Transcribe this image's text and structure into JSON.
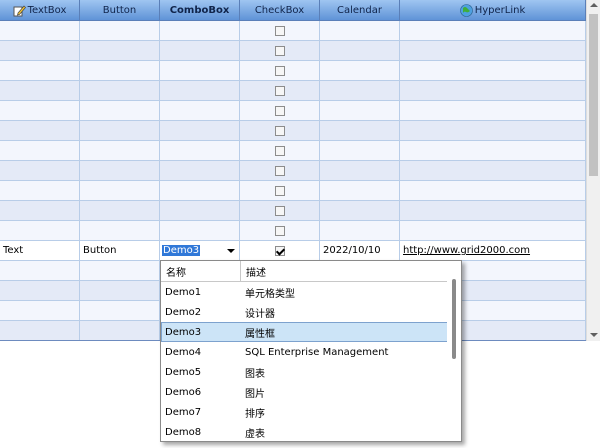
{
  "columns": [
    {
      "label": "TextBox",
      "icon": "pencil-icon",
      "bold": false
    },
    {
      "label": "Button",
      "bold": false
    },
    {
      "label": "ComboBox",
      "bold": true
    },
    {
      "label": "CheckBox",
      "bold": false
    },
    {
      "label": "Calendar",
      "bold": false
    },
    {
      "label": "HyperLink",
      "icon": "globe-icon",
      "bold": false
    }
  ],
  "empty_row_count_above": 11,
  "empty_row_count_below": 4,
  "active_row": {
    "textbox": "Text",
    "button": "Button",
    "combobox": "Demo3",
    "checkbox_checked": true,
    "calendar": "2022/10/10",
    "hyperlink": "http://www.grid2000.com"
  },
  "dropdown": {
    "headers": [
      "名称",
      "描述"
    ],
    "selected_index": 2,
    "items": [
      {
        "name": "Demo1",
        "desc": "单元格类型"
      },
      {
        "name": "Demo2",
        "desc": "设计器"
      },
      {
        "name": "Demo3",
        "desc": "属性框"
      },
      {
        "name": "Demo4",
        "desc": "SQL Enterprise Management"
      },
      {
        "name": "Demo5",
        "desc": "图表"
      },
      {
        "name": "Demo6",
        "desc": "图片"
      },
      {
        "name": "Demo7",
        "desc": "排序"
      },
      {
        "name": "Demo8",
        "desc": "虚表"
      }
    ]
  },
  "colors": {
    "header_top": "#9fc5f1",
    "header_bottom": "#5f93d7",
    "selection": "#3078d8",
    "dropdown_selected": "#cce4f7"
  }
}
